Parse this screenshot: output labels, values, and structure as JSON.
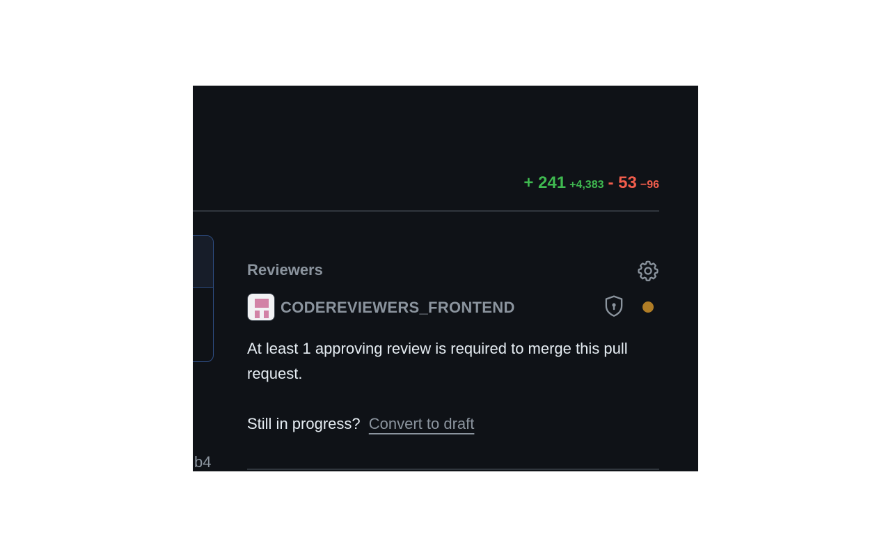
{
  "diffstat": {
    "additions_lines": "+ 241",
    "additions_total": "+4,383",
    "deletions_lines": "- 53",
    "deletions_total": "−96"
  },
  "sidebar_fragment": {
    "hash_fragment": "b4"
  },
  "reviewers": {
    "title": "Reviewers",
    "settings_icon": "gear-icon",
    "team": {
      "name": "CODEREVIEWERS_FRONTEND",
      "avatar_icon": "team-avatar",
      "codeowner_icon": "shield-lock-icon",
      "status": "pending"
    },
    "required_message": "At least 1 approving review is required to merge this pull request.",
    "progress_prompt": "Still in progress?",
    "convert_link": "Convert to draft"
  },
  "colors": {
    "background": "#0f1217",
    "additions": "#3fb950",
    "deletions": "#f05d4c",
    "muted_text": "#8b949e",
    "primary_text": "#e6edf3",
    "pending": "#b07d26",
    "avatar_pink": "#d282a6",
    "card_border": "#2f4f86"
  }
}
